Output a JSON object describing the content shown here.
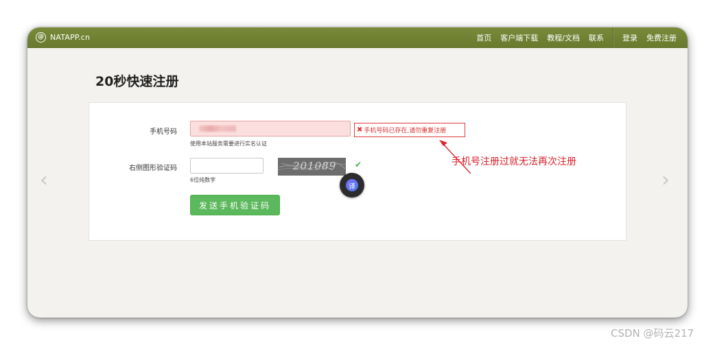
{
  "navbar": {
    "brand": "NATAPP.cn",
    "links": [
      "首页",
      "客户端下载",
      "教程/文档",
      "联系"
    ],
    "auth": [
      "登录",
      "免费注册"
    ]
  },
  "page": {
    "title": "20秒快速注册"
  },
  "form": {
    "phone": {
      "label": "手机号码",
      "hint": "使用本站服务需要进行实名认证",
      "error": "手机号码已存在,请勿重复注册"
    },
    "captcha": {
      "label": "右侧图形验证码",
      "hint": "6位纯数字",
      "code": "201089"
    },
    "submit_label": "发送手机验证码"
  },
  "annotation": {
    "text": "手机号注册过就无法再次注册",
    "color": "#d9232d"
  },
  "translate_badge": "译",
  "watermark": "CSDN @码云217",
  "colors": {
    "navbar": "#6f7f32",
    "button": "#5cb85c",
    "error": "#d92d2d"
  }
}
